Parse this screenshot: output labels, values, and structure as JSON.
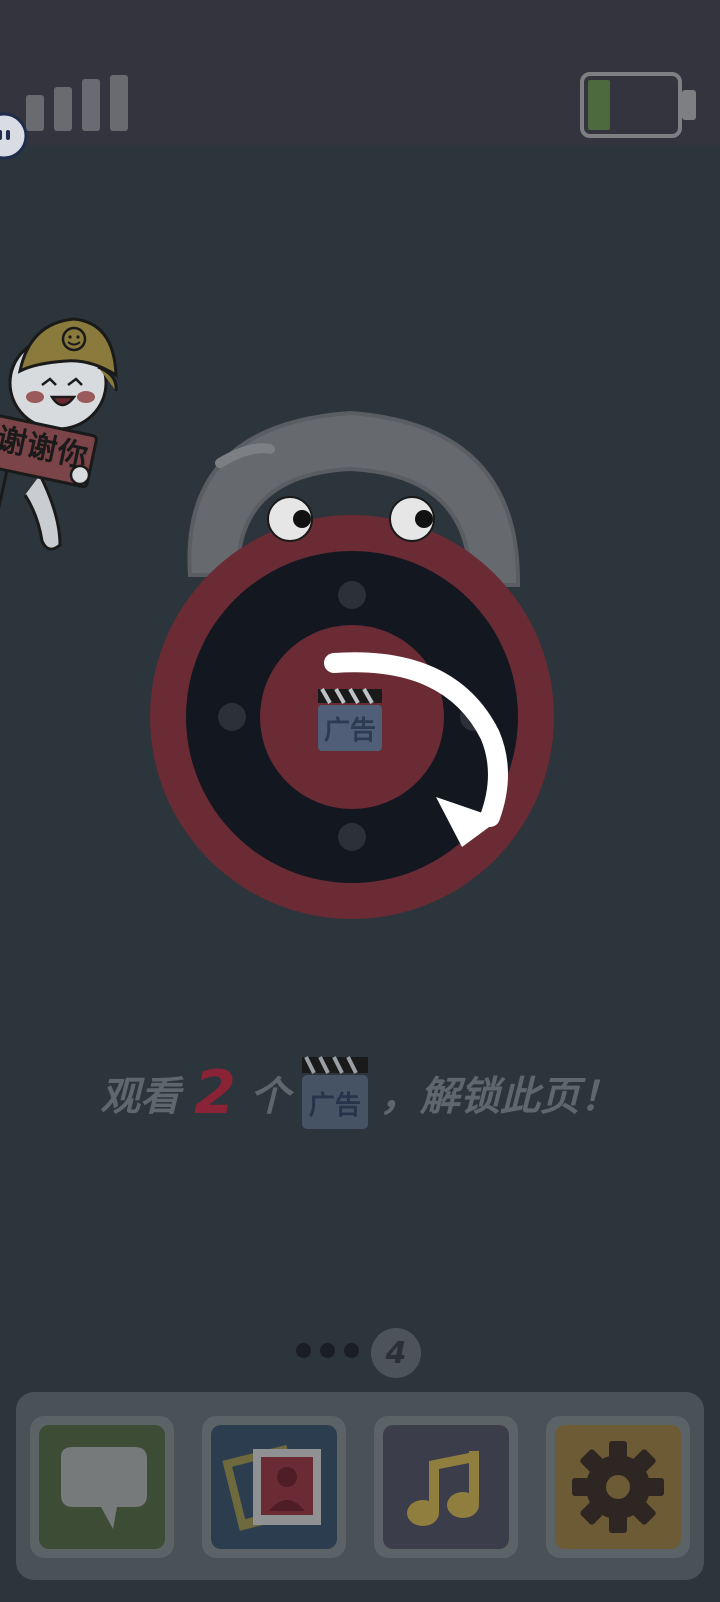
{
  "status_bar": {
    "signal_bars": 4,
    "battery_level": 0.25
  },
  "sticker": {
    "text": "谢谢你"
  },
  "lock": {
    "center_label": "广告"
  },
  "prompt": {
    "before": "观看",
    "count": "2",
    "unit": "个",
    "ad_label": "广告",
    "after": "，解锁此页！"
  },
  "pager": {
    "total_dots": 3,
    "current_page": "4"
  },
  "dock": {
    "apps": [
      {
        "name": "messages",
        "icon": "speech-bubble-icon",
        "color": "#3c4c35"
      },
      {
        "name": "photos",
        "icon": "photo-icon",
        "color": "#2b3d4f"
      },
      {
        "name": "music",
        "icon": "music-note-icon",
        "color": "#3b3d4a"
      },
      {
        "name": "settings",
        "icon": "gear-icon",
        "color": "#6c5b34"
      }
    ]
  },
  "colors": {
    "background": "#2c353b",
    "top_bar": "#33343e",
    "lock_red": "#6a2b35",
    "lock_dark": "#131720",
    "accent_number": "#8a2335"
  }
}
